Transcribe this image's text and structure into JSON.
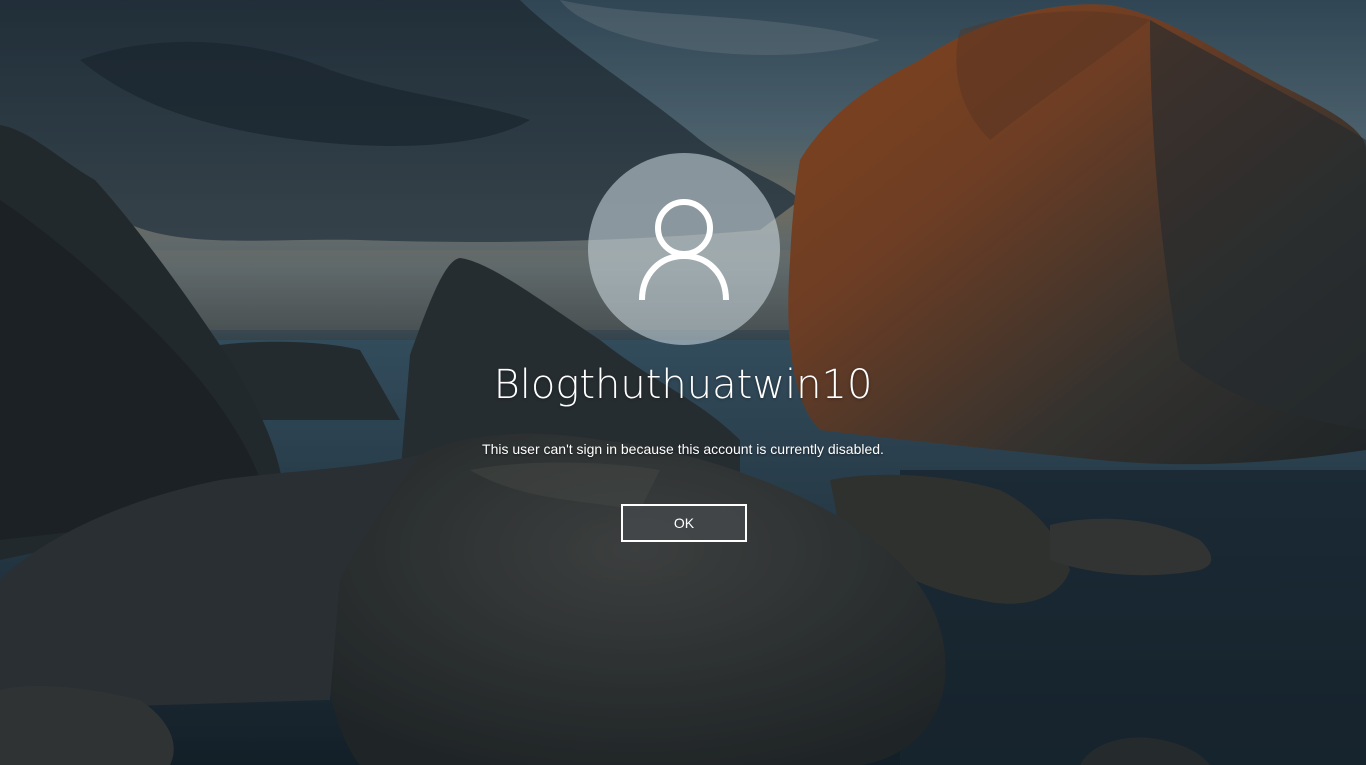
{
  "lock_screen": {
    "user_name": "Blogthuthuatwin10",
    "message": "This user can't sign in because this account is currently disabled.",
    "ok_label": "OK"
  },
  "icons": {
    "avatar": "user-silhouette-icon"
  },
  "colors": {
    "text": "#ffffff",
    "button_border": "#ffffff",
    "avatar_circle": "#c6d3dc"
  }
}
